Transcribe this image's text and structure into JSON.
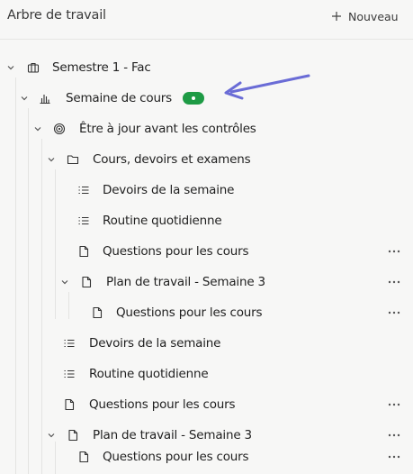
{
  "header": {
    "title": "Arbre de travail",
    "new_label": "Nouveau"
  },
  "colors": {
    "badge": "#1e9b45",
    "arrow": "#6a6cd6"
  },
  "tree": [
    {
      "label": "Semestre 1 - Fac",
      "icon": "briefcase-icon",
      "chevron": true,
      "more": false,
      "badge": false
    },
    {
      "label": "Semaine de cours",
      "icon": "bar-chart-icon",
      "chevron": true,
      "more": false,
      "badge": true
    },
    {
      "label": "Être à jour avant les contrôles",
      "icon": "target-icon",
      "chevron": true,
      "more": false,
      "badge": false
    },
    {
      "label": "Cours, devoirs et examens",
      "icon": "folder-icon",
      "chevron": true,
      "more": false,
      "badge": false
    },
    {
      "label": "Devoirs de la semaine",
      "icon": "list-icon",
      "chevron": false,
      "more": false,
      "badge": false
    },
    {
      "label": "Routine quotidienne",
      "icon": "list-icon",
      "chevron": false,
      "more": false,
      "badge": false
    },
    {
      "label": "Questions pour les cours",
      "icon": "document-icon",
      "chevron": false,
      "more": true,
      "badge": false
    },
    {
      "label": "Plan de travail - Semaine 3",
      "icon": "document-icon",
      "chevron": true,
      "more": true,
      "badge": false
    },
    {
      "label": "Questions pour les cours",
      "icon": "document-icon",
      "chevron": false,
      "more": true,
      "badge": false
    },
    {
      "label": "Devoirs de la semaine",
      "icon": "list-icon",
      "chevron": false,
      "more": false,
      "badge": false
    },
    {
      "label": "Routine quotidienne",
      "icon": "list-icon",
      "chevron": false,
      "more": false,
      "badge": false
    },
    {
      "label": "Questions pour les cours",
      "icon": "document-icon",
      "chevron": false,
      "more": true,
      "badge": false
    },
    {
      "label": "Plan de travail - Semaine 3",
      "icon": "document-icon",
      "chevron": true,
      "more": true,
      "badge": false
    },
    {
      "label": "Questions pour les cours",
      "icon": "document-icon",
      "chevron": false,
      "more": true,
      "badge": false
    }
  ]
}
